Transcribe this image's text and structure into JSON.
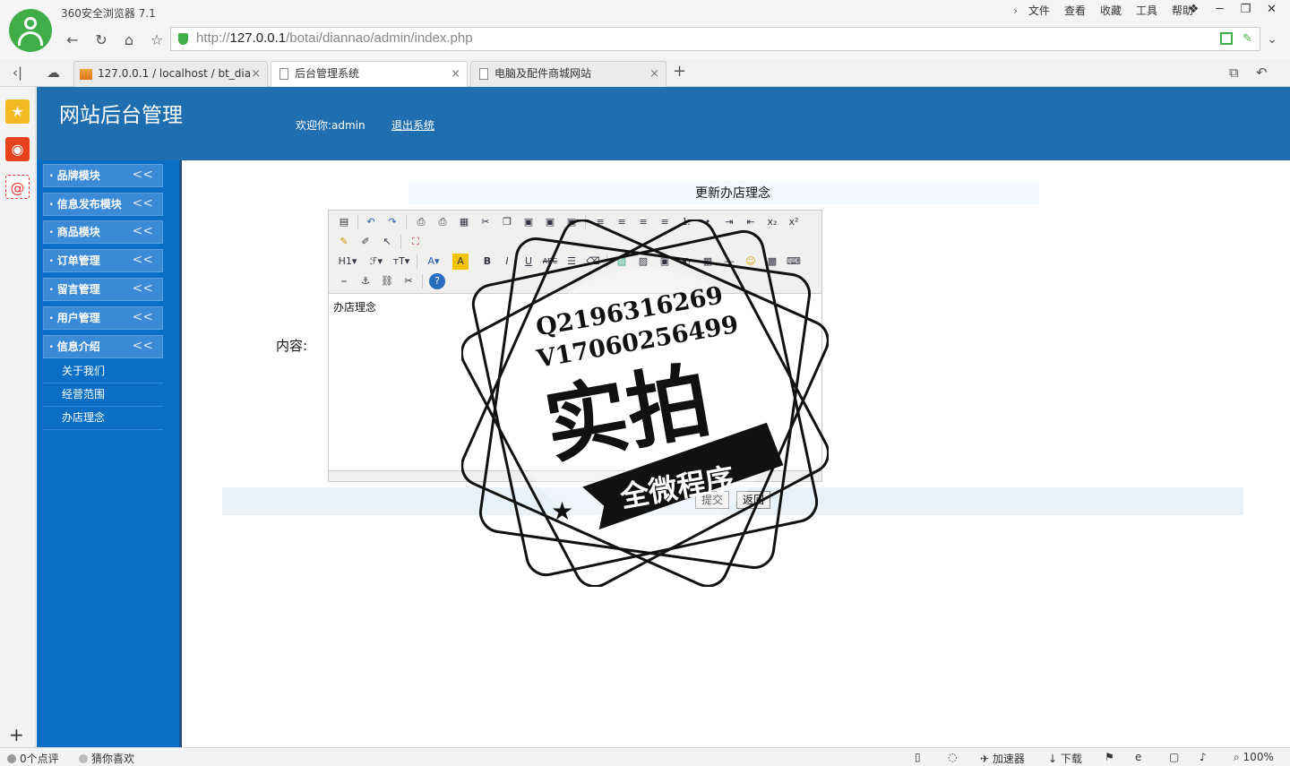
{
  "browser": {
    "title": "360安全浏览器 7.1",
    "menus": [
      "文件",
      "查看",
      "收藏",
      "工具",
      "帮助"
    ],
    "url_prefix": "http://",
    "url_host": "127.0.0.1",
    "url_path": "/botai/diannao/admin/index.php",
    "tabs": [
      {
        "label": "127.0.0.1 / localhost / bt_dia"
      },
      {
        "label": "后台管理系统"
      },
      {
        "label": "电脑及配件商城网站"
      }
    ],
    "status": {
      "comments": "0个点评",
      "guess": "猜你喜欢",
      "accelerator": "加速器",
      "download": "下载",
      "zoom": "100%"
    }
  },
  "app": {
    "title": "网站后台管理",
    "welcome": "欢迎你:admin",
    "logout": "退出系统",
    "sidebar": {
      "menus": [
        {
          "label": "· 品牌模块",
          "arrow": "<<"
        },
        {
          "label": "· 信息发布模块",
          "arrow": "<<"
        },
        {
          "label": "· 商品模块",
          "arrow": "<<"
        },
        {
          "label": "· 订单管理",
          "arrow": "<<"
        },
        {
          "label": "· 留言管理",
          "arrow": "<<"
        },
        {
          "label": "· 用户管理",
          "arrow": "<<"
        },
        {
          "label": "· 信息介绍",
          "arrow": "<<"
        }
      ],
      "submenu": [
        "关于我们",
        "经营范围",
        "办店理念"
      ]
    },
    "form": {
      "title": "更新办店理念",
      "content_label": "内容:",
      "editor_text": "办店理念",
      "submit_label": "提交",
      "back_label": "返回"
    }
  },
  "watermark": {
    "qq": "Q2196316269",
    "wechat": "V17060256499",
    "headline": "实拍",
    "banner": "全微程序"
  }
}
